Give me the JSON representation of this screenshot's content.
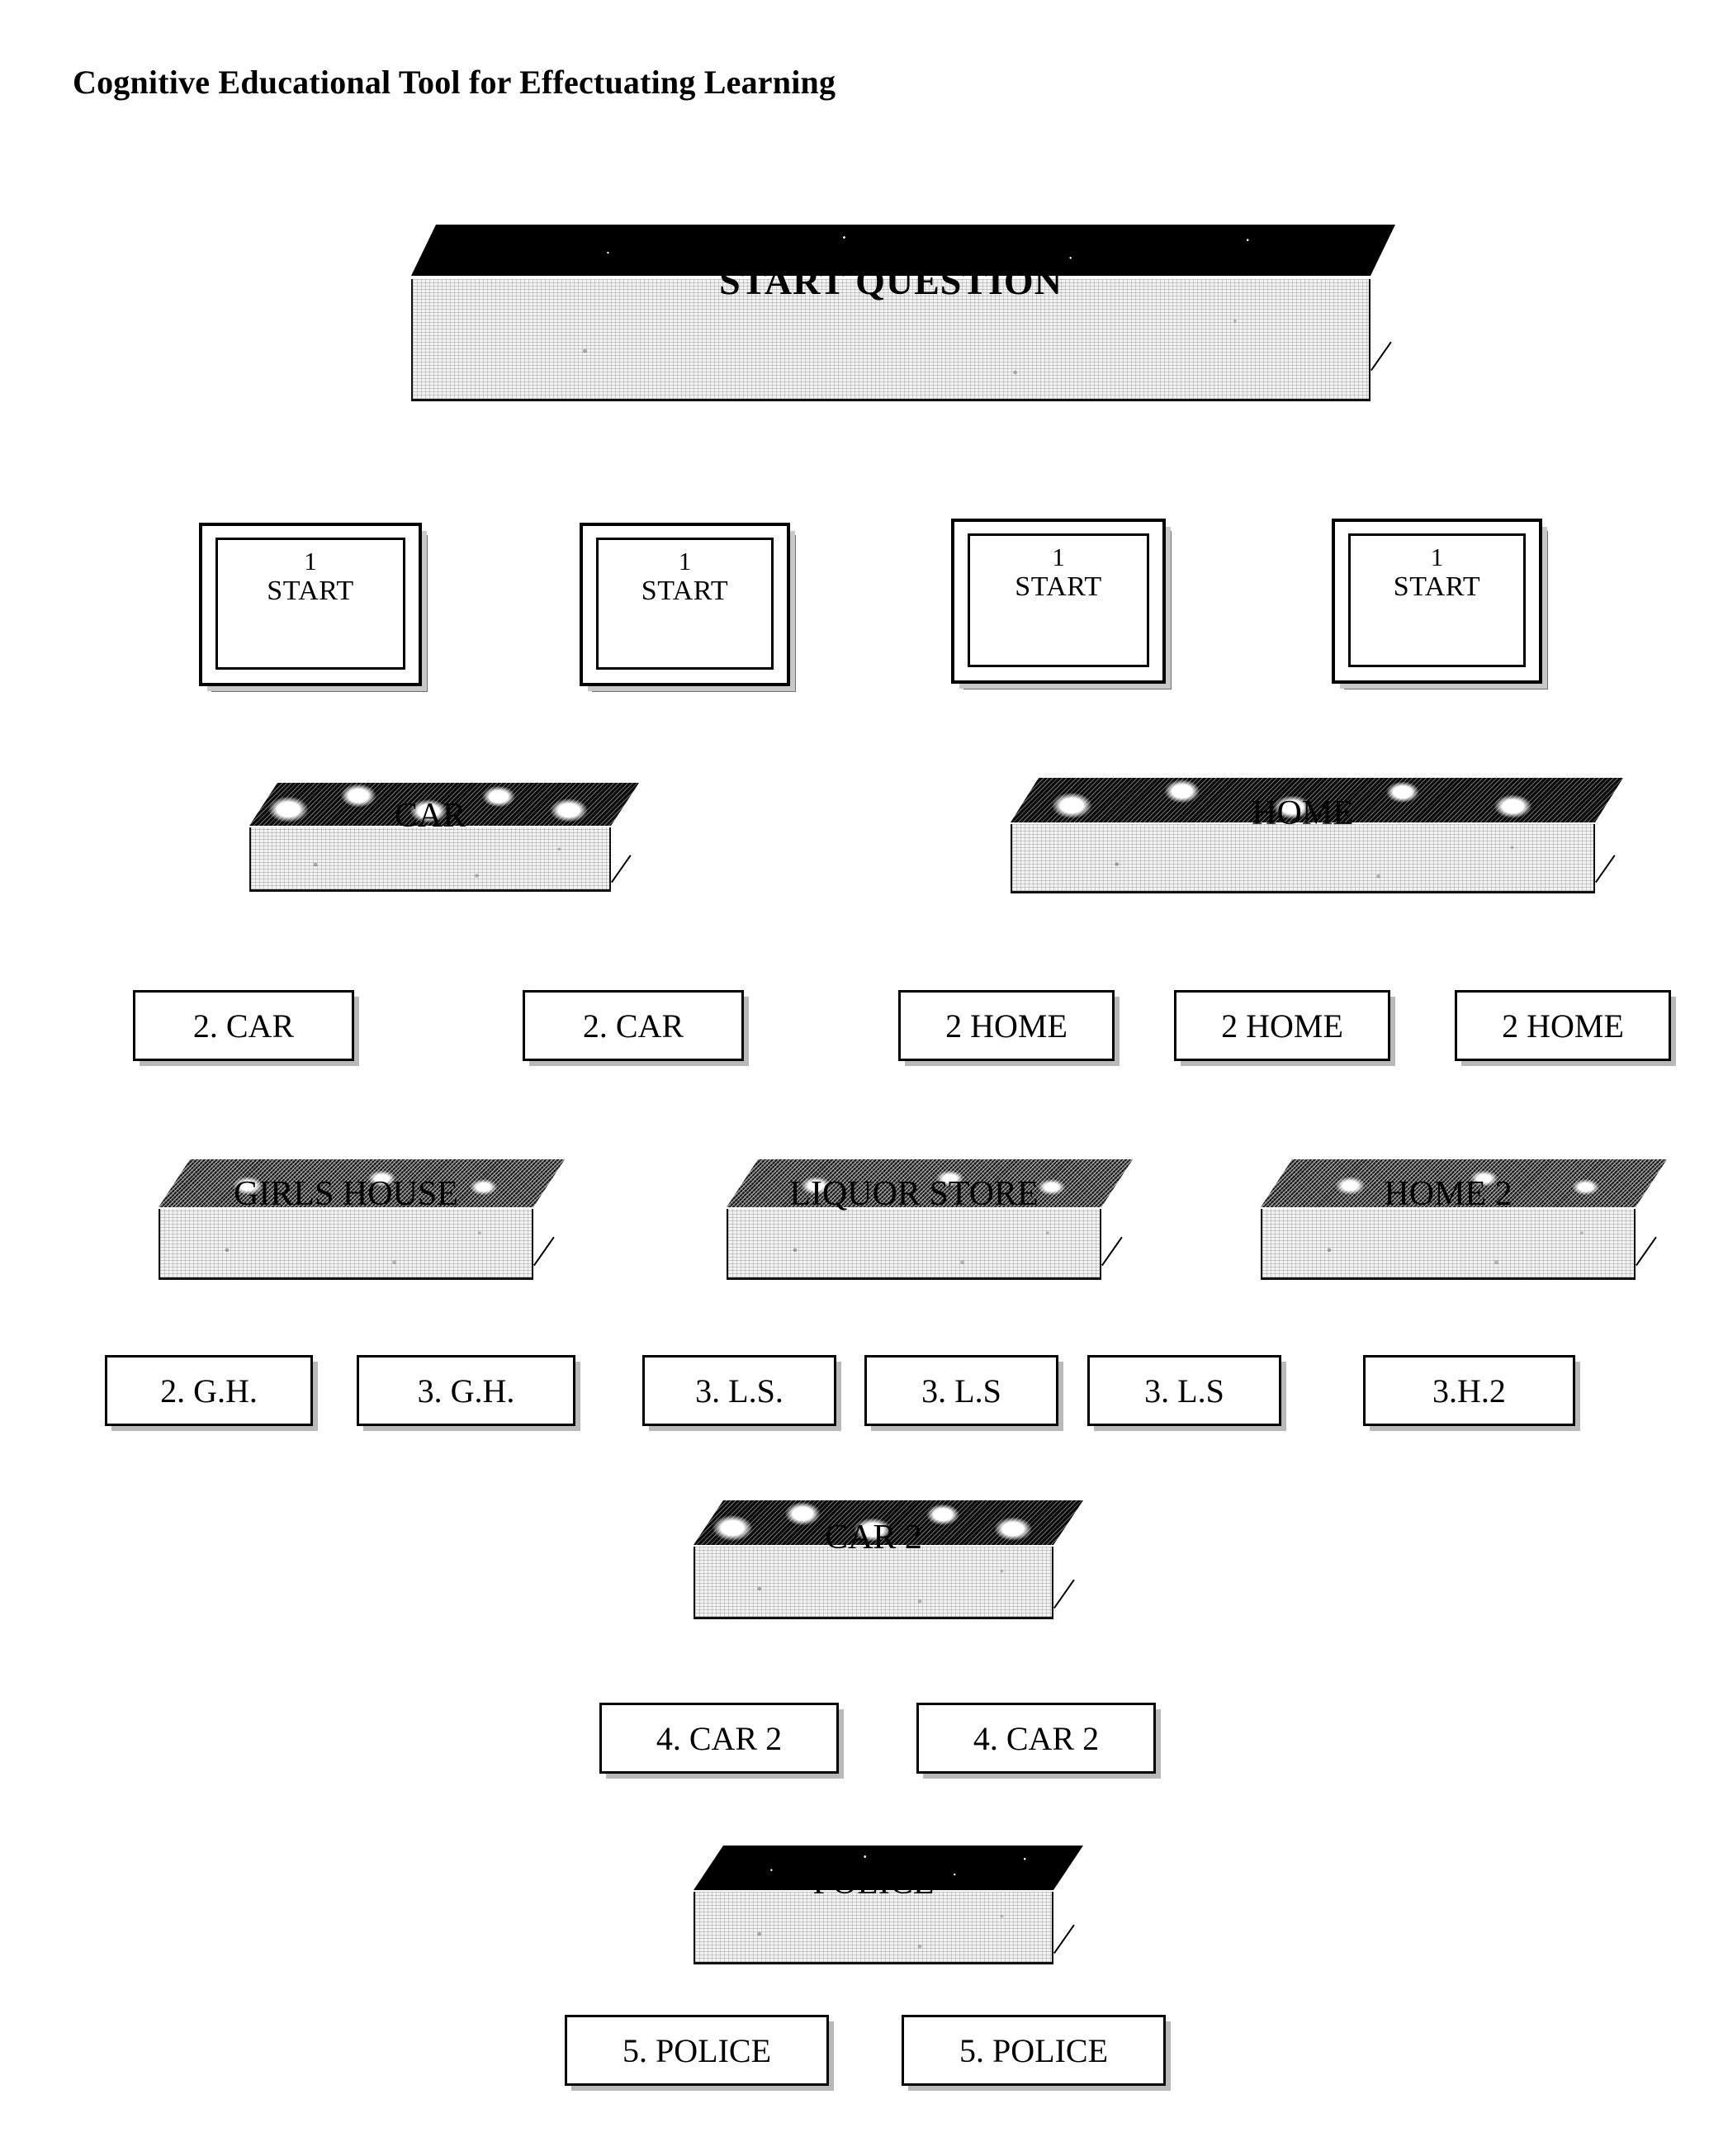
{
  "page": {
    "title": "Cognitive Educational Tool for Effectuating Learning"
  },
  "diagram": {
    "start_question": {
      "label": "START QUESTION"
    },
    "start_cards": [
      {
        "num": "1",
        "word": "START"
      },
      {
        "num": "1",
        "word": "START"
      },
      {
        "num": "1",
        "word": "START"
      },
      {
        "num": "1",
        "word": "START"
      }
    ],
    "level2_slabs": [
      {
        "label": "CAR"
      },
      {
        "label": "HOME"
      }
    ],
    "level2_boxes": [
      {
        "label": "2. CAR"
      },
      {
        "label": "2. CAR"
      },
      {
        "label": "2 HOME"
      },
      {
        "label": "2 HOME"
      },
      {
        "label": "2 HOME"
      }
    ],
    "level3_slabs": [
      {
        "label": "GIRLS HOUSE"
      },
      {
        "label": "LIQUOR STORE"
      },
      {
        "label": "HOME 2"
      }
    ],
    "level3_boxes": [
      {
        "label": "2.  G.H."
      },
      {
        "label": "3. G.H."
      },
      {
        "label": "3. L.S."
      },
      {
        "label": "3. L.S"
      },
      {
        "label": "3. L.S"
      },
      {
        "label": "3.H.2"
      }
    ],
    "level4_slabs": [
      {
        "label": "CAR 2"
      }
    ],
    "level4_boxes": [
      {
        "label": "4. CAR 2"
      },
      {
        "label": "4. CAR 2"
      }
    ],
    "level5_slabs": [
      {
        "label": "POLICE"
      }
    ],
    "level5_boxes": [
      {
        "label": "5. POLICE"
      },
      {
        "label": "5. POLICE"
      }
    ]
  },
  "colors": {
    "ink": "#000000",
    "paper": "#ffffff",
    "slab_top": "#101010",
    "slab_front": "#f2f2f2",
    "shadow": "#6f6f6f"
  }
}
